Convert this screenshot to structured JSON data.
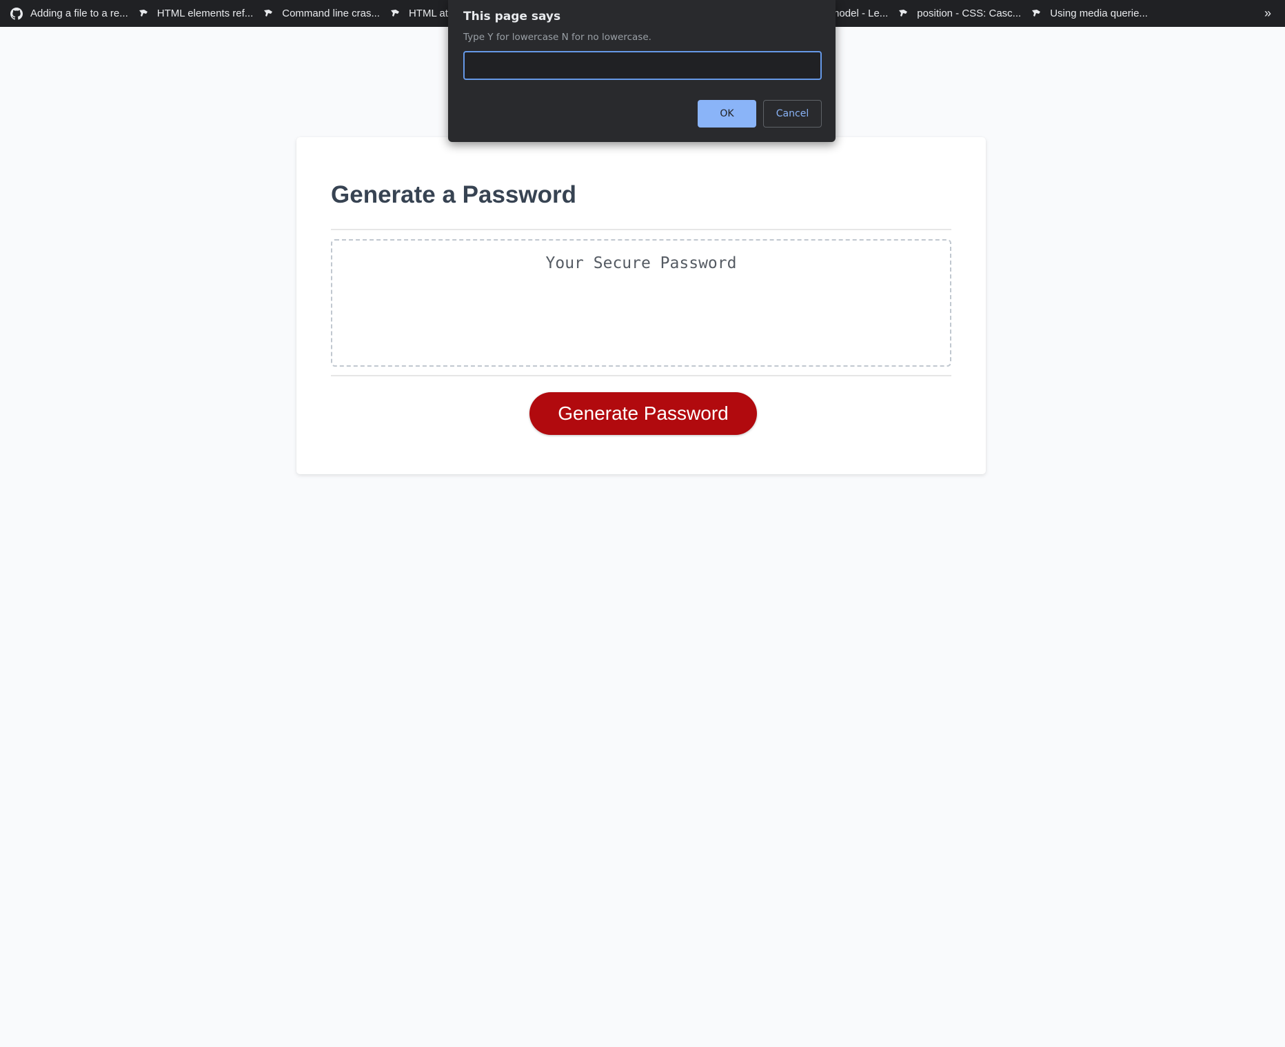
{
  "bookmarks_bar": {
    "items": [
      {
        "label": "Adding a file to a re...",
        "icon": "github-icon"
      },
      {
        "label": "HTML elements ref...",
        "icon": "mdn-icon"
      },
      {
        "label": "Command line cras...",
        "icon": "mdn-icon"
      },
      {
        "label": "HTML at",
        "icon": "mdn-icon"
      },
      {
        "label": "model - Le...",
        "icon": "mdn-icon"
      },
      {
        "label": "position - CSS: Casc...",
        "icon": "mdn-icon"
      },
      {
        "label": "Using media querie...",
        "icon": "mdn-icon"
      }
    ],
    "overflow_label": "»"
  },
  "card": {
    "title": "Generate a Password",
    "password_placeholder": "Your Secure Password",
    "generate_button_label": "Generate Password"
  },
  "dialog": {
    "title": "This page says",
    "message": "Type Y for lowercase N for no lowercase.",
    "input_value": "",
    "ok_label": "OK",
    "cancel_label": "Cancel"
  },
  "colors": {
    "page_background": "#f9fafc",
    "bookmarks_background": "#202124",
    "dialog_background": "#292a2d",
    "dialog_accent": "#8ab4f8",
    "generate_button": "#b10a0e",
    "title_text": "#374352"
  }
}
